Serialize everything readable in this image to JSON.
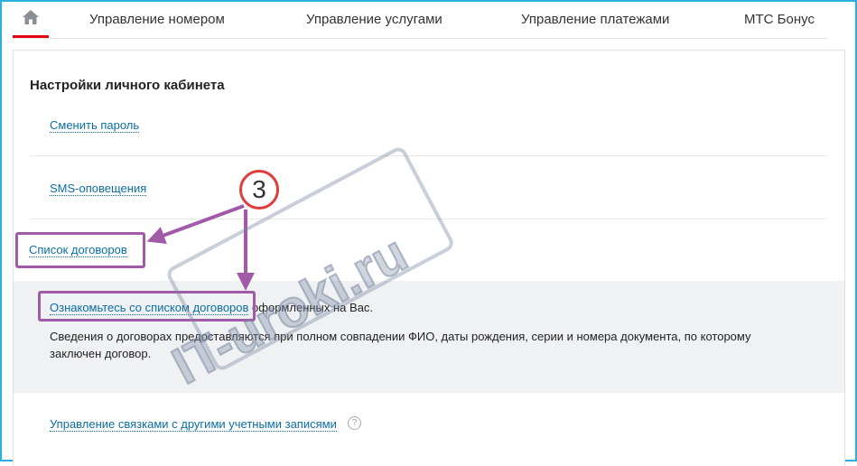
{
  "nav": {
    "items": [
      {
        "label": "Управление номером"
      },
      {
        "label": "Управление услугами"
      },
      {
        "label": "Управление платежами"
      },
      {
        "label": "МТС Бонус"
      }
    ]
  },
  "settings": {
    "title": "Настройки личного кабинета",
    "change_password": "Сменить пароль",
    "sms_notifications": "SMS-оповещения",
    "contracts_list": "Список договоров",
    "contracts_link": "Ознакомьтесь со списком договоров",
    "contracts_link_suffix": " оформленных на Вас.",
    "contracts_info": "Сведения о договорах предоставляются при полном совпадении ФИО, даты рождения, серии и номера документа, по которому заключен договор.",
    "linked_accounts": "Управление связками с другими учетными записями",
    "help_symbol": "?"
  },
  "annotation": {
    "step_number": "3",
    "highlight_color": "#a05aa8",
    "badge_color": "#e13b3b"
  },
  "watermark": {
    "text": "IT-uroki.ru"
  },
  "colors": {
    "accent": "#e30611",
    "link": "#0a6ea6",
    "frame": "#2ab0e0"
  }
}
